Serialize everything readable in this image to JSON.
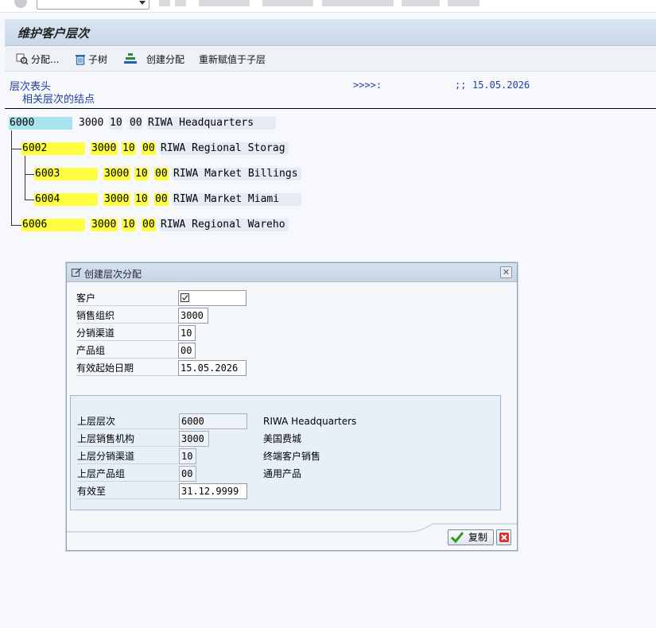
{
  "title": "维护客户层次",
  "toolbar": {
    "assign": "分配...",
    "subtree": "子树",
    "create_assign": "创建分配",
    "reassign": "重新赋值于子层"
  },
  "header": {
    "label1": "层次表头",
    "label2": "相关层次的结点",
    "arrows": ">>>>:",
    "sep": ";;",
    "date": "15.05.2026"
  },
  "tree": [
    {
      "customer": "6000",
      "org": "3000",
      "channel": "10",
      "division": "00",
      "name": "RIWA Headquarters"
    },
    {
      "customer": "6002",
      "org": "3000",
      "channel": "10",
      "division": "00",
      "name": "RIWA Regional Storag"
    },
    {
      "customer": "6003",
      "org": "3000",
      "channel": "10",
      "division": "00",
      "name": "RIWA Market Billings"
    },
    {
      "customer": "6004",
      "org": "3000",
      "channel": "10",
      "division": "00",
      "name": "RIWA Market Miami"
    },
    {
      "customer": "6006",
      "org": "3000",
      "channel": "10",
      "division": "00",
      "name": "RIWA Regional Wareho"
    }
  ],
  "dialog": {
    "title": "创建层次分配",
    "close": "✕",
    "fields": {
      "customer_label": "客户",
      "customer_value": "",
      "sales_org_label": "销售组织",
      "sales_org_value": "3000",
      "channel_label": "分销渠道",
      "channel_value": "10",
      "division_label": "产品组",
      "division_value": "00",
      "valid_from_label": "有效起始日期",
      "valid_from_value": "15.05.2026"
    },
    "higher": {
      "level_label": "上层层次",
      "level_value": "6000",
      "level_desc": "RIWA Headquarters",
      "org_label": "上层销售机构",
      "org_value": "3000",
      "org_desc": "美国费城",
      "channel_label": "上层分销渠道",
      "channel_value": "10",
      "channel_desc": "终端客户销售",
      "division_label": "上层产品组",
      "division_value": "00",
      "division_desc": "通用产品",
      "valid_to_label": "有效至",
      "valid_to_value": "31.12.9999"
    },
    "copy_button": "复制"
  }
}
